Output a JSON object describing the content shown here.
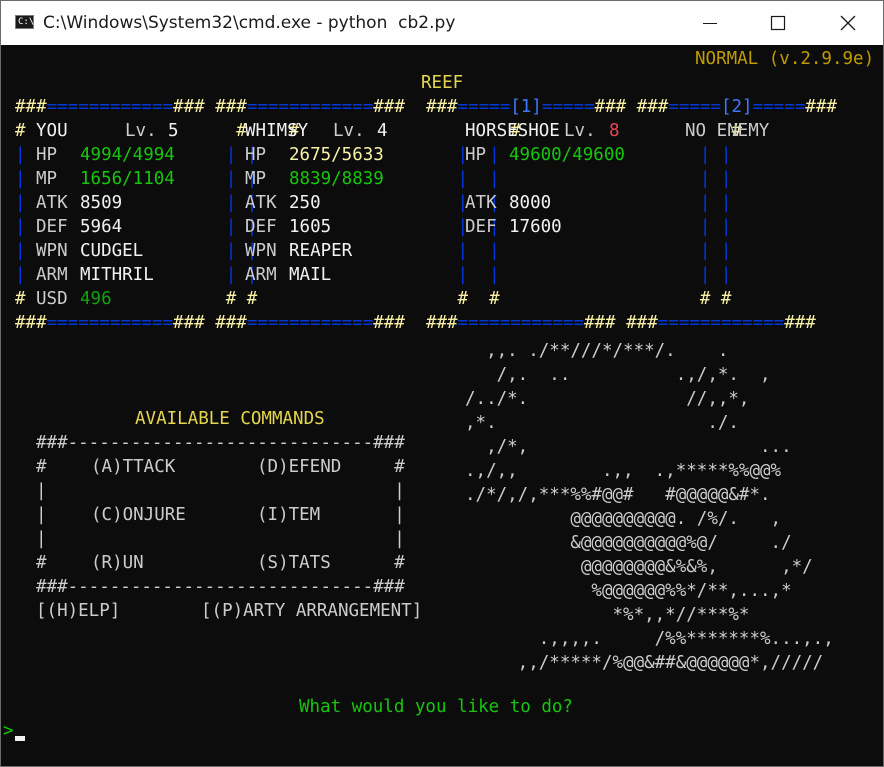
{
  "window": {
    "title": "C:\\Windows\\System32\\cmd.exe - python  cb2.py",
    "icon_glyph": "C:\\",
    "controls": [
      "minimize-icon",
      "maximize-icon",
      "close-icon"
    ]
  },
  "version": "NORMAL (v.2.9.9e)",
  "location": "REEF",
  "panels": {
    "you": {
      "name": "YOU",
      "level_label": "Lv.",
      "level": "5",
      "hp_label": "HP",
      "hp": "4994/4994",
      "mp_label": "MP",
      "mp": "1656/1104",
      "atk_label": "ATK",
      "atk": "8509",
      "def_label": "DEF",
      "def": "5964",
      "wpn_label": "WPN",
      "wpn": "CUDGEL",
      "arm_label": "ARM",
      "arm": "MITHRIL",
      "usd_label": "USD",
      "usd": "496"
    },
    "whimsy": {
      "name": "WHIMSY",
      "level_label": "Lv.",
      "level": "4",
      "hp_label": "HP",
      "hp": "2675/5633",
      "mp_label": "MP",
      "mp": "8839/8839",
      "atk_label": "ATK",
      "atk": "250",
      "def_label": "DEF",
      "def": "1605",
      "wpn_label": "WPN",
      "wpn": "REAPER",
      "arm_label": "ARM",
      "arm": "MAIL"
    },
    "enemy1": {
      "tag": "[1]",
      "name": "HORSESHOE",
      "level_label": "Lv.",
      "level": "8",
      "hp_label": "HP",
      "hp": "49600/49600",
      "atk_label": "ATK",
      "atk": "8000",
      "def_label": "DEF",
      "def": "17600"
    },
    "enemy2": {
      "tag": "[2]",
      "name": "NO ENEMY"
    }
  },
  "commands": {
    "heading": "AVAILABLE COMMANDS",
    "attack": "(A)TTACK",
    "defend": "(D)EFEND",
    "conjure": "(C)ONJURE",
    "item": "(I)TEM",
    "run": "(R)UN",
    "stats": "(S)TATS",
    "help": "[(H)ELP]",
    "party": "[(P)ARTY ARRANGEMENT]"
  },
  "art": "  ,,. ./**///*/***/.    .\n   /,.  ..          .,/,*.  ,\n/../*.               //,,*,\n,*.                    ./.\n  ,/*,                      ...\n.,/,,        .,,  .,*****%%@@%\n./*/,/,***%%#@@#   #@@@@@&#*.\n          @@@@@@@@@@. /%/.   ,\n          &@@@@@@@@@@%@/     ./\n           @@@@@@@@&%&%,      ,*/\n            %@@@@@@%%*/**,...,*\n              *%*,,*//***%*\n       .,,,,.     /%%*******%...,.,\n     ,,/*****/%@@&##&@@@@@@*,/////",
  "prompt": {
    "question": "What would you like to do?",
    "cursor": ">"
  }
}
